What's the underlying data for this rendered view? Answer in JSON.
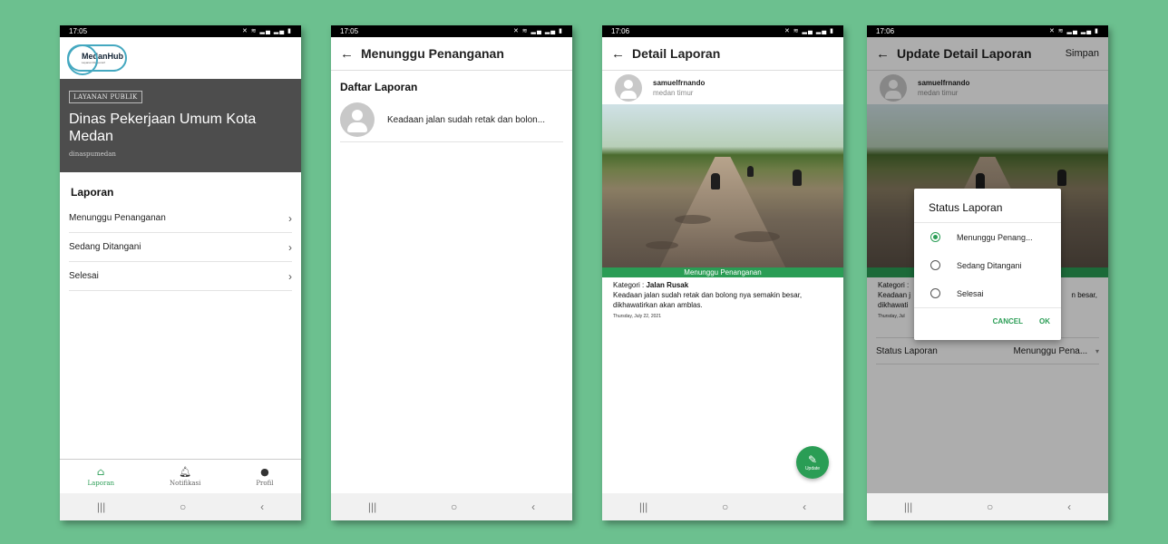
{
  "colors": {
    "background": "#6cc08f",
    "accent": "#2a9d55",
    "hero": "#4d4d4d"
  },
  "nav_icons": [
    "menu-icon",
    "home-circle-icon",
    "back-icon"
  ],
  "phone1": {
    "time": "17:05",
    "logo": {
      "name": "MedanHub",
      "tagline": "Layanan Responsif"
    },
    "hero": {
      "tag": "LAYANAN PUBLIK",
      "title": "Dinas Pekerjaan Umum Kota Medan",
      "subtitle": "dinaspumedan"
    },
    "section_title": "Laporan",
    "menu": [
      {
        "label": "Menunggu Penanganan"
      },
      {
        "label": "Sedang Ditangani"
      },
      {
        "label": "Selesai"
      }
    ],
    "bottom_nav": [
      {
        "label": "Laporan",
        "icon": "home-icon",
        "active": true
      },
      {
        "label": "Notifikasi",
        "icon": "bell-icon"
      },
      {
        "label": "Profil",
        "icon": "person-icon"
      }
    ]
  },
  "phone2": {
    "time": "17:05",
    "title": "Menunggu Penanganan",
    "list_title": "Daftar Laporan",
    "items": [
      {
        "text": "Keadaan jalan sudah retak dan bolon..."
      }
    ]
  },
  "phone3": {
    "time": "17:06",
    "title": "Detail Laporan",
    "user": {
      "name": "samuelfrnando",
      "location": "medan timur"
    },
    "status": "Menunggu Penanganan",
    "kategori_label": "Kategori :",
    "kategori_value": "Jalan Rusak",
    "description": "Keadaan jalan sudah retak dan bolong nya semakin besar, dikhawatirkan akan amblas.",
    "date": "Thursday, July 22, 2021",
    "fab_label": "Update"
  },
  "phone4": {
    "time": "17:06",
    "title": "Update Detail Laporan",
    "action": "Simpan",
    "field_label": "Status Laporan",
    "field_value": "Menunggu Pena...",
    "dialog": {
      "title": "Status Laporan",
      "options": [
        {
          "label": "Menunggu Penang...",
          "checked": true
        },
        {
          "label": "Sedang Ditangani"
        },
        {
          "label": "Selesai"
        }
      ],
      "cancel": "CANCEL",
      "ok": "OK"
    },
    "behind_kategori": "Kategori :",
    "behind_desc_1": "Keadaan j",
    "behind_desc_2": "n besar,",
    "behind_desc_3": "dikhawati",
    "behind_date": "Thursday, Jul"
  }
}
